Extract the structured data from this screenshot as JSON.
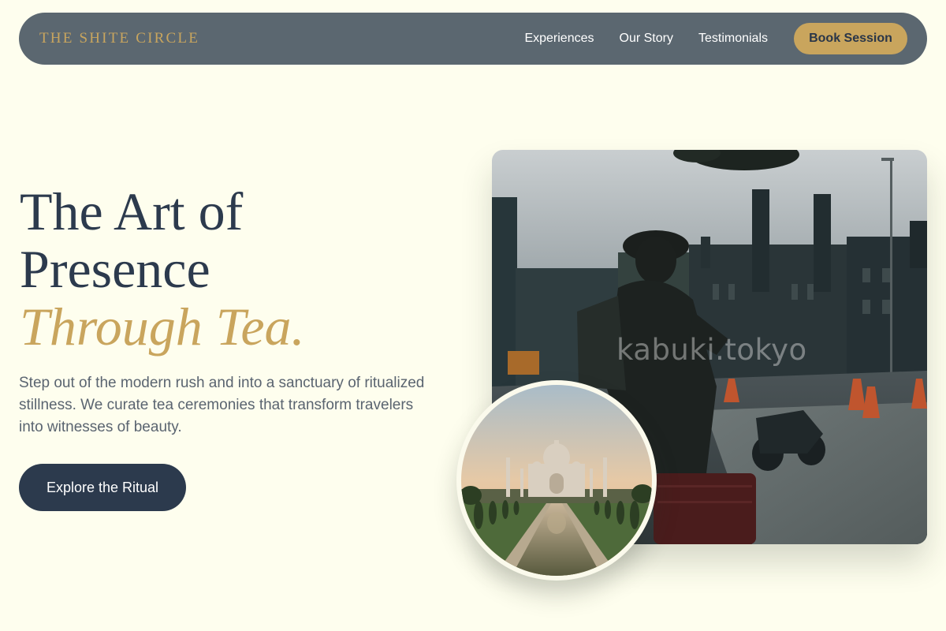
{
  "nav": {
    "logo": "THE SHITE CIRCLE",
    "links": [
      "Experiences",
      "Our Story",
      "Testimonials"
    ],
    "cta": "Book Session"
  },
  "hero": {
    "title_line1": "The Art of",
    "title_line2": "Presence",
    "title_accent": "Through Tea.",
    "description": "Step out of the modern rush and into a sanctuary of ritualized stillness. We curate tea ceremonies that transform travelers into witnesses of beauty.",
    "cta": "Explore the Ritual"
  },
  "images": {
    "main_watermark": "kabuki.tokyo"
  },
  "colors": {
    "background": "#fefeee",
    "nav": "#5b6770",
    "gold": "#c9a55d",
    "navy": "#2c3a4d"
  }
}
